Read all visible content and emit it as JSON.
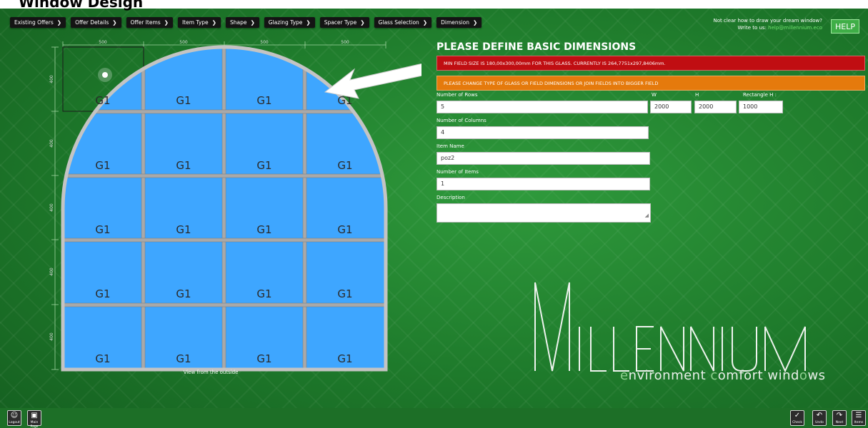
{
  "page_heading": "Window Design",
  "breadcrumbs": [
    {
      "label": "Existing Offers"
    },
    {
      "label": "Offer Details"
    },
    {
      "label": "Offer Items"
    },
    {
      "label": "Item Type"
    },
    {
      "label": "Shape"
    },
    {
      "label": "Glazing Type"
    },
    {
      "label": "Spacer Type"
    },
    {
      "label": "Glass Selection"
    },
    {
      "label": "Dimension"
    }
  ],
  "help": {
    "line1": "Not clear how to draw your dream window?",
    "line2_prefix": "Write to us: ",
    "email": "help@millennium.eco",
    "button": "HELP"
  },
  "drawing": {
    "top_dims": [
      "500",
      "500",
      "500",
      "500"
    ],
    "side_dims": [
      "400",
      "400",
      "400",
      "400",
      "400"
    ],
    "glass_label": "G1",
    "rows": 5,
    "cols": 4,
    "caption": "View from the outside",
    "colors": {
      "glass": "#3ea6ff",
      "frame": "#bdbdbd",
      "mullion": "#a7a7a7"
    }
  },
  "form": {
    "title": "PLEASE DEFINE BASIC DIMENSIONS",
    "alert_red": "MIN FIELD SIZE IS 180,00x300,00mm FOR THIS GLASS. CURRENTLY IS 264,7751x297,8406mm.",
    "alert_orange": "PLEASE CHANGE TYPE OF GLASS OR FIELD DIMENSIONS OR JOIN FIELDS INTO BIGGER FIELD",
    "rows_label": "Number of Rows",
    "rows_value": "5",
    "w_label": "W",
    "w_value": "2000",
    "h_label": "H",
    "h_value": "2000",
    "rect_label": "Rectangle H :",
    "rect_value": "1000",
    "cols_label": "Number of Columns",
    "cols_value": "4",
    "item_name_label": "Item Name",
    "item_name_value": "poz2",
    "items_label": "Number of Items",
    "items_value": "1",
    "description_label": "Description",
    "description_value": ""
  },
  "logo": {
    "brand": "MILLENNIUM",
    "tag_e": "e",
    "tag_1": "nvironment ",
    "tag_c": "c",
    "tag_2": "omfort wind",
    "tag_o": "o",
    "tag_3": "ws"
  },
  "toolbar": {
    "logout": "Logout",
    "main_page": "Main Page",
    "check": "Check",
    "undo": "Undo",
    "next": "Next",
    "items": "Items"
  }
}
